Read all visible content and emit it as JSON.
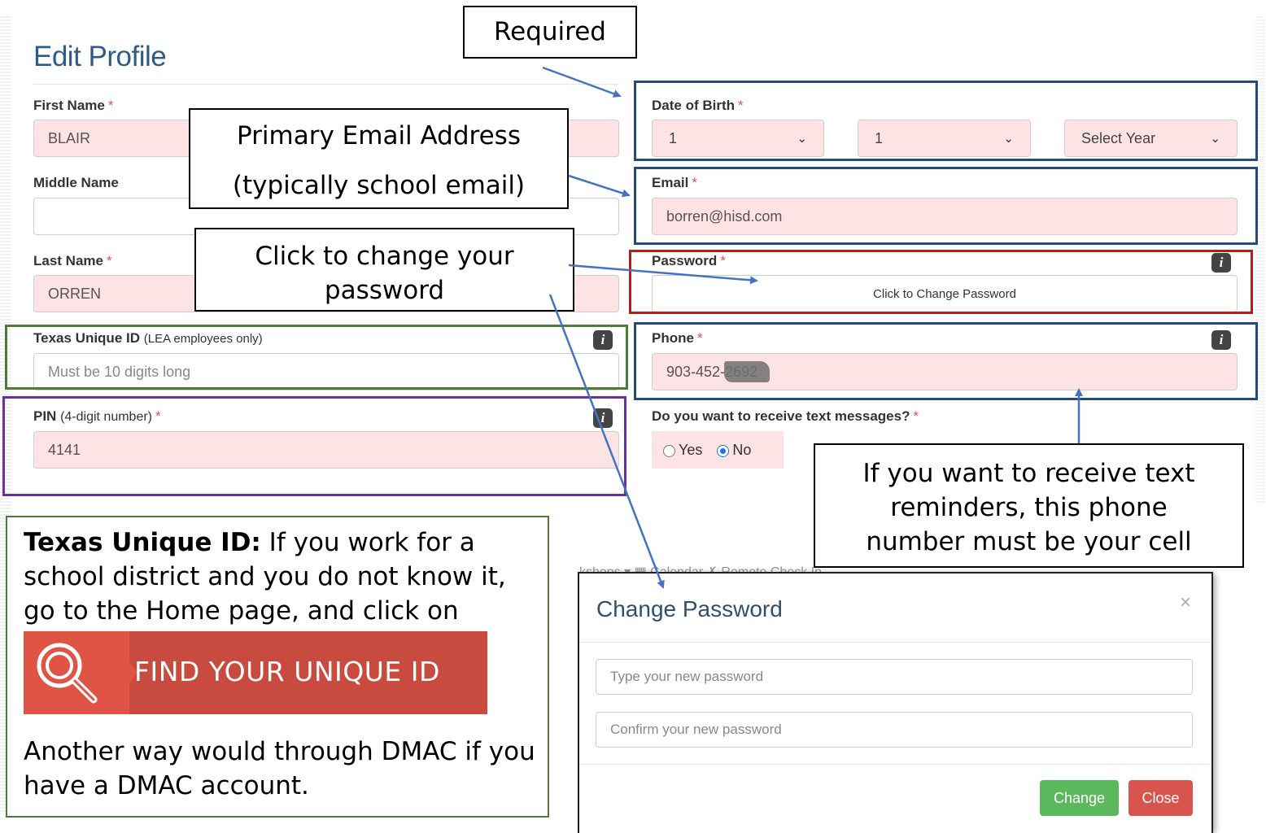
{
  "title": "Edit Profile",
  "left_form": {
    "first_name": {
      "label": "First Name",
      "value": "BLAIR"
    },
    "middle_name": {
      "label": "Middle Name",
      "value": ""
    },
    "last_name": {
      "label": "Last Name",
      "value": "ORREN"
    },
    "texas_id": {
      "label": "Texas Unique ID",
      "sub": "(LEA employees only)",
      "placeholder": "Must be 10 digits long"
    },
    "pin": {
      "label": "PIN",
      "sub": "(4-digit number)",
      "value": "4141"
    }
  },
  "right_form": {
    "dob": {
      "label": "Date of Birth",
      "month": "1",
      "day": "1",
      "year": "Select Year"
    },
    "email": {
      "label": "Email",
      "value": "borren@hisd.com"
    },
    "password": {
      "label": "Password",
      "button": "Click to Change Password"
    },
    "phone": {
      "label": "Phone",
      "value": "903-452-2692"
    },
    "text_messages": {
      "label": "Do you want to receive text messages?",
      "yes": "Yes",
      "no": "No",
      "selected": "No"
    }
  },
  "required_mark": "*",
  "info_glyph": "i",
  "callouts": {
    "required": "Required",
    "email_line1": "Primary Email Address",
    "email_line2": "(typically school email)",
    "password_line1": "Click to change your",
    "password_line2": "password",
    "phone_line1": "If you want to receive text",
    "phone_line2": "reminders, this phone",
    "phone_line3": "number must be your cell"
  },
  "note": {
    "bold": "Texas Unique ID:",
    "text1": " If you work for a school district and you do not know it, go to the Home page, and click on",
    "find_button": "FIND YOUR UNIQUE ID",
    "text2": "Another way would through DMAC if you have a DMAC account."
  },
  "modal": {
    "top_strip": "kshops  ▾   ▦  Calendar      ✗ Remote Check In",
    "title": "Change Password",
    "close_glyph": "×",
    "new_placeholder": "Type your new password",
    "confirm_placeholder": "Confirm your new password",
    "change": "Change",
    "close": "Close"
  },
  "colors": {
    "title": "#2f5c86",
    "required": "#d9534f",
    "field_bg": "#fde3e3",
    "box_blue": "#264b80",
    "box_red": "#b71c1c",
    "box_green": "#4f7b36",
    "box_purple": "#6b2fa0",
    "arrow": "#4472c4",
    "btn_change": "#5cb85c",
    "btn_close": "#d9534f"
  },
  "icons": [
    "info-icon",
    "chevron-down-icon",
    "magnifier-icon",
    "close-icon",
    "arrow"
  ]
}
